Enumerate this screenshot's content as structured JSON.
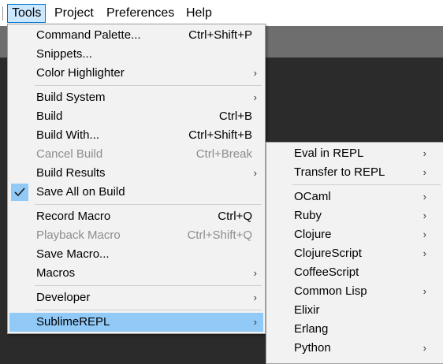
{
  "menubar": {
    "items": [
      {
        "label": "Tools",
        "active": true
      },
      {
        "label": "Project"
      },
      {
        "label": "Preferences"
      },
      {
        "label": "Help"
      }
    ]
  },
  "tools_menu": {
    "items": [
      {
        "label": "Command Palette...",
        "shortcut": "Ctrl+Shift+P"
      },
      {
        "label": "Snippets..."
      },
      {
        "label": "Color Highlighter",
        "submenu": true
      },
      {
        "label": "Build System",
        "submenu": true
      },
      {
        "label": "Build",
        "shortcut": "Ctrl+B"
      },
      {
        "label": "Build With...",
        "shortcut": "Ctrl+Shift+B"
      },
      {
        "label": "Cancel Build",
        "shortcut": "Ctrl+Break",
        "disabled": true
      },
      {
        "label": "Build Results",
        "submenu": true
      },
      {
        "label": "Save All on Build",
        "checked": true
      },
      {
        "label": "Record Macro",
        "shortcut": "Ctrl+Q"
      },
      {
        "label": "Playback Macro",
        "shortcut": "Ctrl+Shift+Q",
        "disabled": true
      },
      {
        "label": "Save Macro..."
      },
      {
        "label": "Macros",
        "submenu": true
      },
      {
        "label": "Developer",
        "submenu": true
      },
      {
        "label": "SublimeREPL",
        "submenu": true,
        "highlighted": true
      }
    ]
  },
  "sublimerepl_menu": {
    "items": [
      {
        "label": "Eval in REPL",
        "submenu": true
      },
      {
        "label": "Transfer to REPL",
        "submenu": true
      },
      {
        "label": "OCaml",
        "submenu": true
      },
      {
        "label": "Ruby",
        "submenu": true
      },
      {
        "label": "Clojure",
        "submenu": true
      },
      {
        "label": "ClojureScript",
        "submenu": true
      },
      {
        "label": "CoffeeScript"
      },
      {
        "label": "Common Lisp",
        "submenu": true
      },
      {
        "label": "Elixir"
      },
      {
        "label": "Erlang"
      },
      {
        "label": "Python",
        "submenu": true
      }
    ]
  },
  "icons": {
    "submenu_arrow": "chevron-right-icon",
    "checkmark": "checkmark-icon"
  },
  "colors": {
    "highlight": "#91c9f7",
    "menu_background": "#f2f2f2",
    "active_menubar_border": "#0078d7",
    "disabled_text": "#8d8d8d"
  }
}
